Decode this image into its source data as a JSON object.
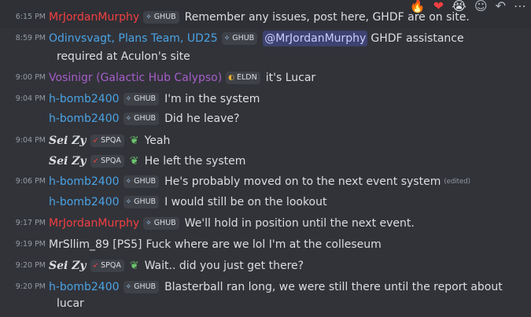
{
  "toolbar": {
    "reactions": [
      "🔥",
      "❤",
      "😭"
    ],
    "icons": [
      "add-reaction-icon",
      "reply-icon",
      "more-icon"
    ],
    "icon_glyphs": [
      "☺",
      "↶",
      "⋯"
    ]
  },
  "colors": {
    "mrjordan": "#f23f42",
    "blue": "#4aa3e5",
    "purple": "#a55ec9",
    "white": "#dbdee1"
  },
  "messages": [
    {
      "time": "6:15 PM",
      "author": "MrJordanMurphy",
      "tag": "GHUB",
      "text": "Remember any issues, post here, GHDF are on site."
    },
    {
      "time": "8:59 PM",
      "author": "Odinvsvagt, Plans Team, UD25",
      "tag": "GHUB",
      "mention": "@MrJordanMurphy",
      "text": "GHDF assistance",
      "text2": "required at Aculon's site"
    },
    {
      "time": "9:00 PM",
      "author": "Vosinigr (Galactic Hub Calypso)",
      "tag": "ELDN",
      "text": "it's Lucar"
    },
    {
      "time": "9:04 PM",
      "author": "h-bomb2400",
      "tag": "GHUB",
      "text": "I'm in the system"
    },
    {
      "time": "",
      "author": "h-bomb2400",
      "tag": "GHUB",
      "text": "Did he leave?"
    },
    {
      "time": "9:04 PM",
      "author": "Sei Zy",
      "tag": "SPQA",
      "text": "Yeah"
    },
    {
      "time": "",
      "author": "Sei Zy",
      "tag": "SPQA",
      "text": "He left the system"
    },
    {
      "time": "9:06 PM",
      "author": "h-bomb2400",
      "tag": "GHUB",
      "text": "He's probably moved on to the next event system",
      "edited": "(edited)"
    },
    {
      "time": "",
      "author": "h-bomb2400",
      "tag": "GHUB",
      "text": "I would still be on the lookout"
    },
    {
      "time": "9:17 PM",
      "author": "MrJordanMurphy",
      "tag": "GHUB",
      "text": "We'll hold in position until the next event."
    },
    {
      "time": "9:19 PM",
      "author": "MrSllim_89 [PS5]",
      "tag": "",
      "text": "Fuck where are we lol I'm at the colleseum"
    },
    {
      "time": "9:20 PM",
      "author": "Sei Zy",
      "tag": "SPQA",
      "text": "Wait.. did you just get there?"
    },
    {
      "time": "9:20 PM",
      "author": "h-bomb2400",
      "tag": "GHUB",
      "text": "Blasterball ran long, we were still there until the report about",
      "text2": "lucar"
    }
  ]
}
